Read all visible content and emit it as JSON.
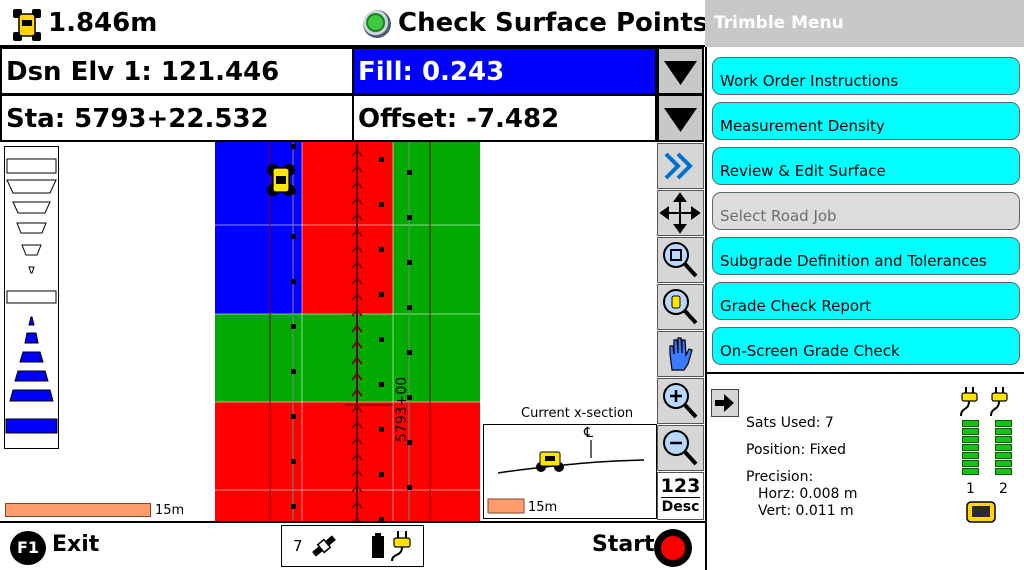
{
  "topbar": {
    "elevation": "1.846m",
    "title": "Check Surface Points"
  },
  "readouts": {
    "dsn_elv": "Dsn Elv 1: 121.446",
    "fill": "Fill: 0.243",
    "station": "Sta: 5793+22.532",
    "offset": "Offset: -7.482"
  },
  "map": {
    "station_label": "5793+00",
    "scale": "15m",
    "colors": {
      "cut": "#0000ff",
      "fill": "#ff0000",
      "on_grade": "#00aa00"
    }
  },
  "xsection": {
    "label": "Current x-section",
    "scale": "15m"
  },
  "tools": {
    "desc_label_top": "123",
    "desc_label_bottom": "Desc"
  },
  "bottombar": {
    "f1": "F1",
    "exit": "Exit",
    "sat_count": "7",
    "start": "Start"
  },
  "menu": {
    "title": "Trimble Menu",
    "items": [
      {
        "label": "Work Order Instructions",
        "enabled": true
      },
      {
        "label": "Measurement Density",
        "enabled": true
      },
      {
        "label": "Review & Edit Surface",
        "enabled": true
      },
      {
        "label": "Select Road Job",
        "enabled": false
      },
      {
        "label": "Subgrade Definition and Tolerances",
        "enabled": true
      },
      {
        "label": "Grade Check Report",
        "enabled": true
      },
      {
        "label": "On-Screen Grade Check",
        "enabled": true
      }
    ]
  },
  "status": {
    "sats_used": "Sats Used: 7",
    "position": "Position: Fixed",
    "precision_label": "Precision:",
    "horz": "Horz: 0.008 m",
    "vert": "Vert: 0.011 m",
    "receiver_1": "1",
    "receiver_2": "2"
  }
}
